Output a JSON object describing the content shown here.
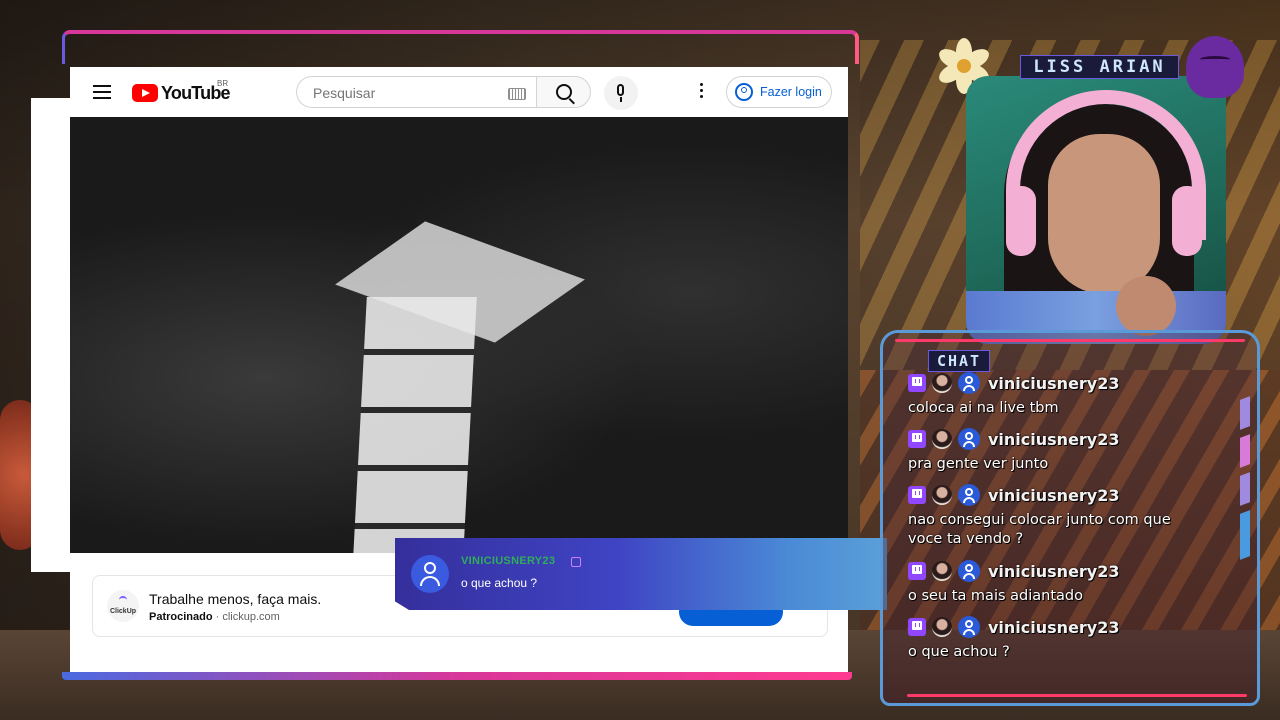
{
  "youtube": {
    "logo_text": "YouTube",
    "country_code": "BR",
    "search": {
      "placeholder": "Pesquisar",
      "value": ""
    },
    "login_label": "Fazer login",
    "ad": {
      "brand_logo_text": "ClickUp",
      "title": "Trabalhe menos, faça mais.",
      "sponsored_label": "Patrocinado",
      "separator": " · ",
      "domain": "clickup.com"
    }
  },
  "overlay": {
    "streamer_name": "LISS ARIAN",
    "chat_label": "CHAT",
    "popup": {
      "username": "VINICIUSNERY23",
      "message": "o que achou ?"
    },
    "chat_messages": [
      {
        "user": "viniciusnery23",
        "text": "coloca ai na live tbm"
      },
      {
        "user": "viniciusnery23",
        "text": "pra gente ver junto"
      },
      {
        "user": "viniciusnery23",
        "text": "nao consegui colocar junto com que voce ta vendo ?"
      },
      {
        "user": "viniciusnery23",
        "text": "o seu ta mais adiantado"
      },
      {
        "user": "viniciusnery23",
        "text": "o que achou ?"
      }
    ]
  },
  "colors": {
    "youtube_red": "#ff0000",
    "link_blue": "#065fd4",
    "twitch_purple": "#9146ff",
    "neon_pink": "#d8379a",
    "popup_username_green": "#2fae5a"
  }
}
